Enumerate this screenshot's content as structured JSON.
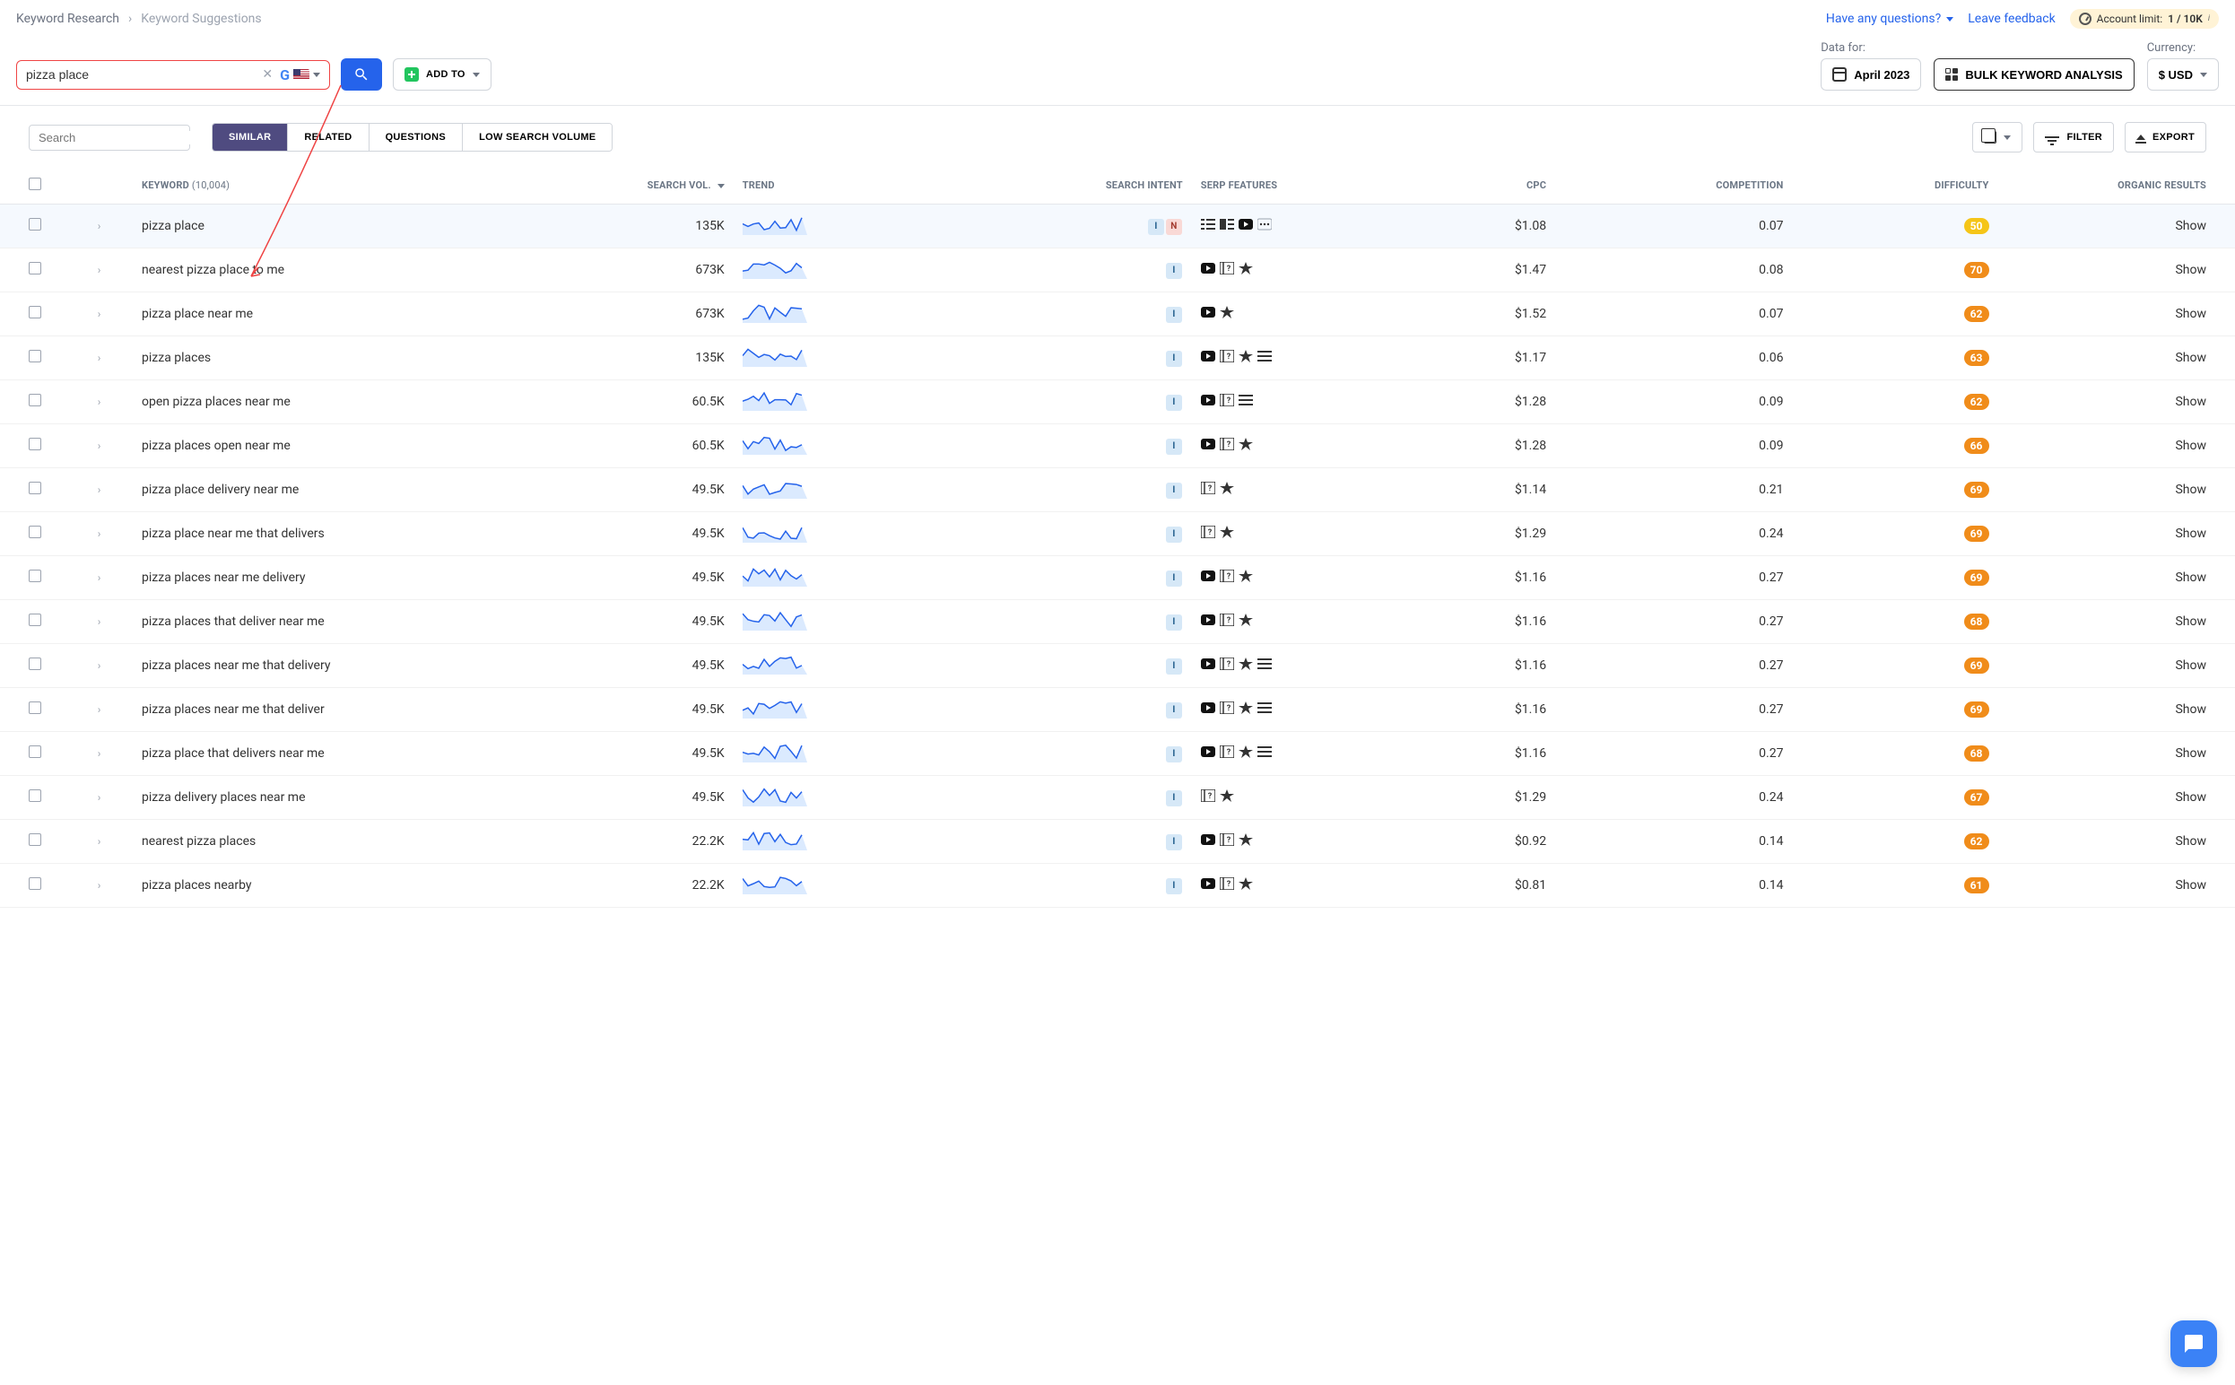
{
  "breadcrumb": {
    "root": "Keyword Research",
    "leaf": "Keyword Suggestions"
  },
  "topbar": {
    "questions": "Have any questions?",
    "feedback": "Leave feedback",
    "account_label": "Account limit:",
    "account_value": "1 / 10K"
  },
  "search": {
    "value": "pizza place",
    "engine": "google",
    "country": "us"
  },
  "buttons": {
    "addto": "ADD TO",
    "data_for_label": "Data for:",
    "data_for_value": "April 2023",
    "bulk": "BULK KEYWORD ANALYSIS",
    "currency_label": "Currency:",
    "currency_value": "$ USD"
  },
  "toolbar": {
    "search_placeholder": "Search",
    "tabs": [
      "SIMILAR",
      "RELATED",
      "QUESTIONS",
      "LOW SEARCH VOLUME"
    ],
    "active_tab": 0,
    "copy": "",
    "filter": "FILTER",
    "export": "EXPORT"
  },
  "columns": {
    "keyword": "KEYWORD",
    "keyword_count": "(10,004)",
    "search_vol": "SEARCH VOL.",
    "trend": "TREND",
    "intent": "SEARCH INTENT",
    "serp": "SERP FEATURES",
    "cpc": "CPC",
    "competition": "COMPETITION",
    "difficulty": "DIFFICULTY",
    "organic": "ORGANIC RESULTS"
  },
  "show_label": "Show",
  "rows": [
    {
      "hl": true,
      "kw": "pizza place",
      "vol": "135K",
      "intent": [
        "I",
        "N"
      ],
      "serp": [
        "list",
        "featured",
        "video",
        "more"
      ],
      "cpc": "$1.08",
      "comp": "0.07",
      "diff": 50,
      "diff_class": "diff-50"
    },
    {
      "hl": false,
      "kw": "nearest pizza place to me",
      "vol": "673K",
      "intent": [
        "I"
      ],
      "serp": [
        "video",
        "faq",
        "star"
      ],
      "cpc": "$1.47",
      "comp": "0.08",
      "diff": 70,
      "diff_class": "diff-or"
    },
    {
      "hl": false,
      "kw": "pizza place near me",
      "vol": "673K",
      "intent": [
        "I"
      ],
      "serp": [
        "video",
        "star"
      ],
      "cpc": "$1.52",
      "comp": "0.07",
      "diff": 62,
      "diff_class": "diff-or"
    },
    {
      "hl": false,
      "kw": "pizza places",
      "vol": "135K",
      "intent": [
        "I"
      ],
      "serp": [
        "video",
        "faq",
        "star",
        "menu"
      ],
      "cpc": "$1.17",
      "comp": "0.06",
      "diff": 63,
      "diff_class": "diff-or"
    },
    {
      "hl": false,
      "kw": "open pizza places near me",
      "vol": "60.5K",
      "intent": [
        "I"
      ],
      "serp": [
        "video",
        "faq",
        "menu"
      ],
      "cpc": "$1.28",
      "comp": "0.09",
      "diff": 62,
      "diff_class": "diff-or"
    },
    {
      "hl": false,
      "kw": "pizza places open near me",
      "vol": "60.5K",
      "intent": [
        "I"
      ],
      "serp": [
        "video",
        "faq",
        "star"
      ],
      "cpc": "$1.28",
      "comp": "0.09",
      "diff": 66,
      "diff_class": "diff-or"
    },
    {
      "hl": false,
      "kw": "pizza place delivery near me",
      "vol": "49.5K",
      "intent": [
        "I"
      ],
      "serp": [
        "faq",
        "star"
      ],
      "cpc": "$1.14",
      "comp": "0.21",
      "diff": 69,
      "diff_class": "diff-or"
    },
    {
      "hl": false,
      "kw": "pizza place near me that delivers",
      "vol": "49.5K",
      "intent": [
        "I"
      ],
      "serp": [
        "faq",
        "star"
      ],
      "cpc": "$1.29",
      "comp": "0.24",
      "diff": 69,
      "diff_class": "diff-or"
    },
    {
      "hl": false,
      "kw": "pizza places near me delivery",
      "vol": "49.5K",
      "intent": [
        "I"
      ],
      "serp": [
        "video",
        "faq",
        "star"
      ],
      "cpc": "$1.16",
      "comp": "0.27",
      "diff": 69,
      "diff_class": "diff-or"
    },
    {
      "hl": false,
      "kw": "pizza places that deliver near me",
      "vol": "49.5K",
      "intent": [
        "I"
      ],
      "serp": [
        "video",
        "faq",
        "star"
      ],
      "cpc": "$1.16",
      "comp": "0.27",
      "diff": 68,
      "diff_class": "diff-or"
    },
    {
      "hl": false,
      "kw": "pizza places near me that delivery",
      "vol": "49.5K",
      "intent": [
        "I"
      ],
      "serp": [
        "video",
        "faq",
        "star",
        "menu"
      ],
      "cpc": "$1.16",
      "comp": "0.27",
      "diff": 69,
      "diff_class": "diff-or"
    },
    {
      "hl": false,
      "kw": "pizza places near me that deliver",
      "vol": "49.5K",
      "intent": [
        "I"
      ],
      "serp": [
        "video",
        "faq",
        "star",
        "menu"
      ],
      "cpc": "$1.16",
      "comp": "0.27",
      "diff": 69,
      "diff_class": "diff-or"
    },
    {
      "hl": false,
      "kw": "pizza place that delivers near me",
      "vol": "49.5K",
      "intent": [
        "I"
      ],
      "serp": [
        "video",
        "faq",
        "star",
        "menu"
      ],
      "cpc": "$1.16",
      "comp": "0.27",
      "diff": 68,
      "diff_class": "diff-or"
    },
    {
      "hl": false,
      "kw": "pizza delivery places near me",
      "vol": "49.5K",
      "intent": [
        "I"
      ],
      "serp": [
        "faq",
        "star"
      ],
      "cpc": "$1.29",
      "comp": "0.24",
      "diff": 67,
      "diff_class": "diff-or"
    },
    {
      "hl": false,
      "kw": "nearest pizza places",
      "vol": "22.2K",
      "intent": [
        "I"
      ],
      "serp": [
        "video",
        "faq",
        "star"
      ],
      "cpc": "$0.92",
      "comp": "0.14",
      "diff": 62,
      "diff_class": "diff-or"
    },
    {
      "hl": false,
      "kw": "pizza places nearby",
      "vol": "22.2K",
      "intent": [
        "I"
      ],
      "serp": [
        "video",
        "faq",
        "star"
      ],
      "cpc": "$0.81",
      "comp": "0.14",
      "diff": 61,
      "diff_class": "diff-or"
    }
  ]
}
